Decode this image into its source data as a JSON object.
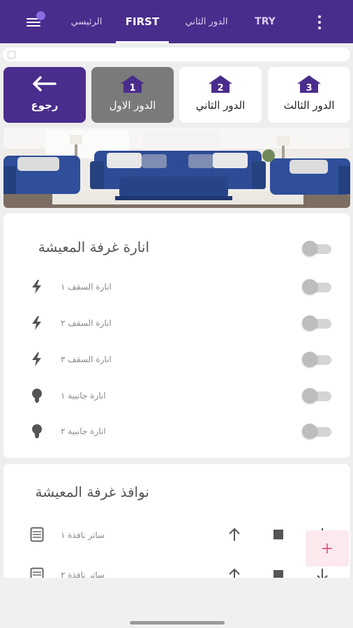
{
  "tabs": [
    {
      "label": "TRY"
    },
    {
      "label": "الدور الثاني"
    },
    {
      "label": "FIRST"
    },
    {
      "label": "الرئيسي"
    }
  ],
  "floors": {
    "back_label": "رجوع",
    "first": {
      "label": "الدور الاول",
      "badge": "1"
    },
    "second": {
      "label": "الدور الثاني",
      "badge": "2"
    },
    "third": {
      "label": "الدور الثالث",
      "badge": "3"
    }
  },
  "lighting": {
    "title": "انارة غرفة المعيشة",
    "items": [
      {
        "label": "انارة السقف ١",
        "icon": "bolt-icon"
      },
      {
        "label": "انارة السقف ٢",
        "icon": "bolt-icon"
      },
      {
        "label": "انارة السقف ٣",
        "icon": "bolt-icon"
      },
      {
        "label": "انارة جانبية ١",
        "icon": "bulb-icon"
      },
      {
        "label": "انارة جانبية ٢",
        "icon": "bulb-icon"
      }
    ]
  },
  "windows": {
    "title": "نوافذ غرفة المعيشة",
    "items": [
      {
        "label": "ساتر نافذة ١"
      },
      {
        "label": "ساتر نافذة ٢"
      }
    ]
  },
  "colors": {
    "primary": "#4a2c8c",
    "current_floor": "#7a7a7a",
    "fab_accent": "#e05a8c"
  }
}
